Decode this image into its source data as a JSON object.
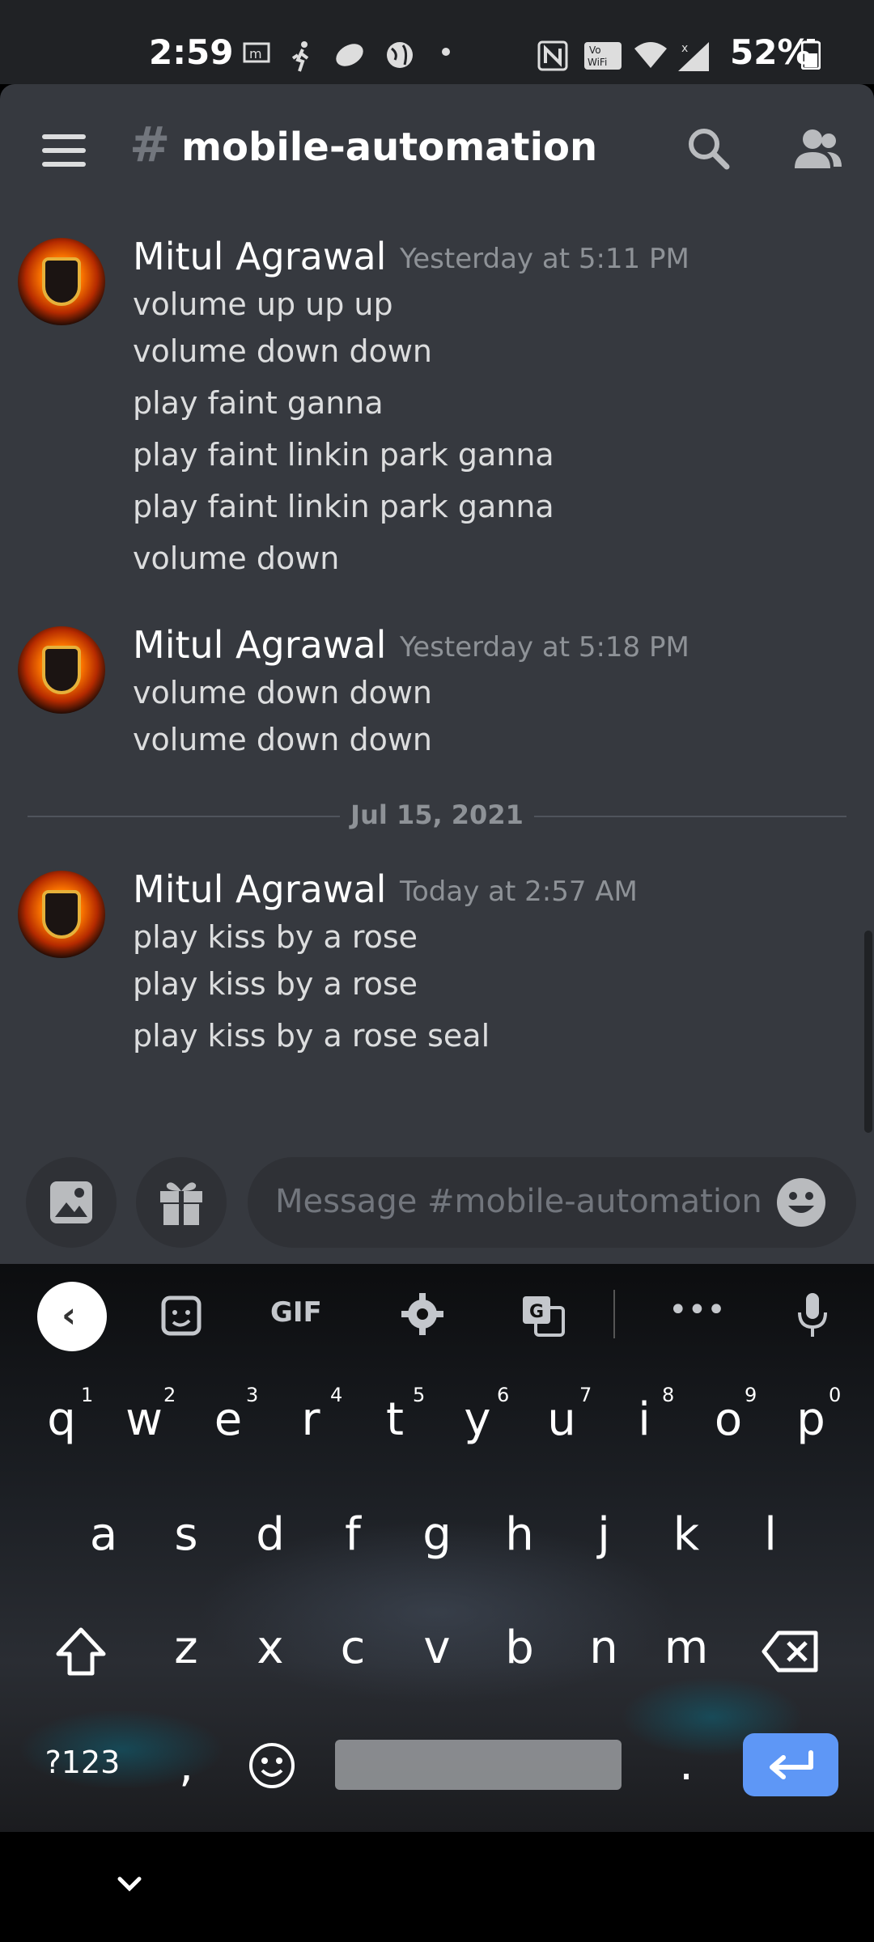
{
  "status_bar": {
    "time": "2:59",
    "battery": "52%"
  },
  "header": {
    "channel_hash": "#",
    "channel_name": "mobile-automation"
  },
  "messages": [
    {
      "author": "Mitul Agrawal",
      "timestamp": "Yesterday at 5:11 PM",
      "lines": [
        "volume up up up",
        "volume down down",
        "play faint ganna",
        "play faint linkin park ganna",
        "play faint linkin park ganna",
        "volume down"
      ]
    },
    {
      "author": "Mitul Agrawal",
      "timestamp": "Yesterday at 5:18 PM",
      "lines": [
        "volume down down",
        "volume down down"
      ]
    },
    {
      "author": "Mitul Agrawal",
      "timestamp": "Today at 2:57 AM",
      "lines": [
        "play kiss by a rose",
        "play kiss by a rose",
        "play kiss by a rose seal"
      ]
    }
  ],
  "date_divider": "Jul 15, 2021",
  "composer": {
    "placeholder": "Message #mobile-automation"
  },
  "keyboard": {
    "toolbar": {
      "gif_label": "GIF",
      "more_label": "•••"
    },
    "row1": [
      "q",
      "w",
      "e",
      "r",
      "t",
      "y",
      "u",
      "i",
      "o",
      "p"
    ],
    "row1_hints": [
      "1",
      "2",
      "3",
      "4",
      "5",
      "6",
      "7",
      "8",
      "9",
      "0"
    ],
    "row2": [
      "a",
      "s",
      "d",
      "f",
      "g",
      "h",
      "j",
      "k",
      "l"
    ],
    "row3": [
      "z",
      "x",
      "c",
      "v",
      "b",
      "n",
      "m"
    ],
    "symbols_label": "?123",
    "comma": ",",
    "period": "."
  }
}
